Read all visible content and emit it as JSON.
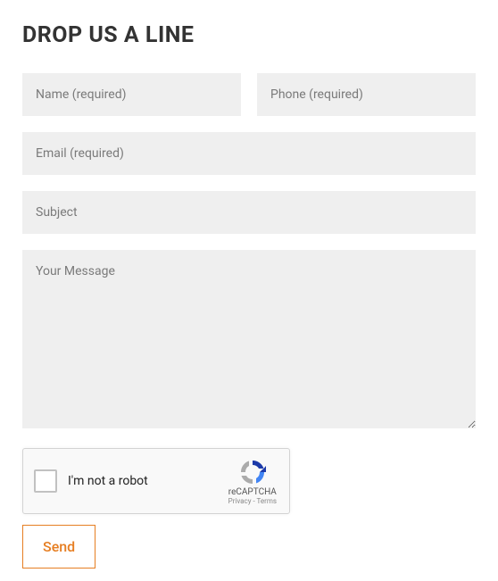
{
  "title": "DROP US A LINE",
  "fields": {
    "name_placeholder": "Name (required)",
    "phone_placeholder": "Phone (required)",
    "email_placeholder": "Email (required)",
    "subject_placeholder": "Subject",
    "message_placeholder": "Your Message"
  },
  "recaptcha": {
    "label": "I'm not a robot",
    "brand": "reCAPTCHA",
    "terms": "Privacy - Terms"
  },
  "submit_label": "Send"
}
